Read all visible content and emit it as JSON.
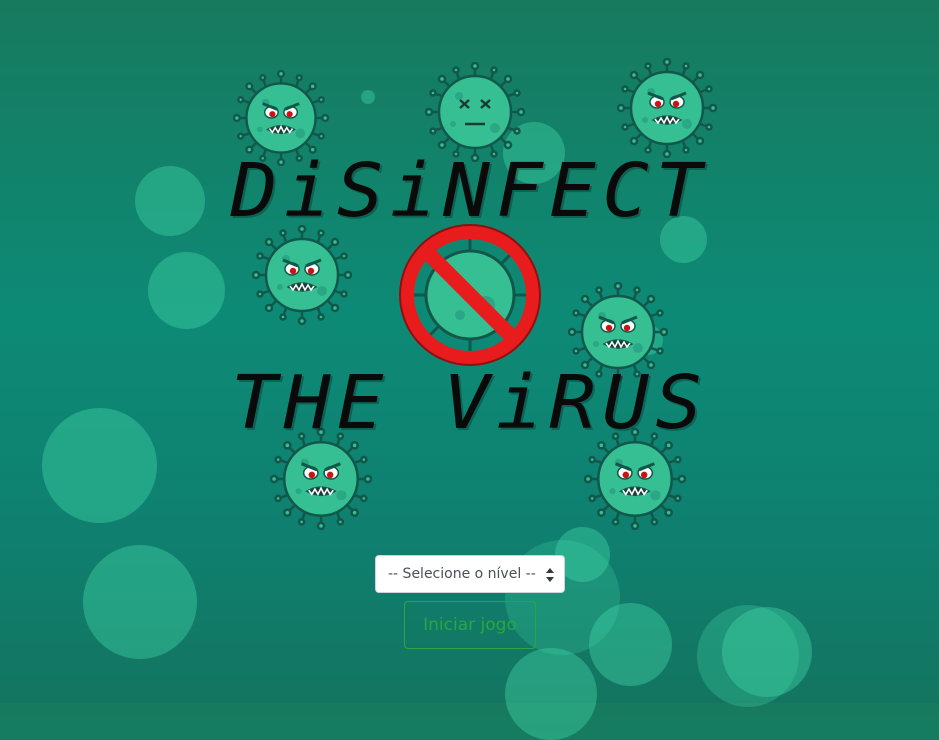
{
  "title": {
    "line1": "DiSiNFECT",
    "line2": "THE ViRUS"
  },
  "level_select": {
    "selected": "-- Selecione o nível --",
    "options": [
      "-- Selecione o nível --"
    ]
  },
  "start_button": {
    "label": "Iniciar jogo"
  },
  "icons": {
    "virus": "angry-virus-icon",
    "dead_virus": "dead-virus-icon",
    "no_virus": "no-virus-icon",
    "select_arrows": "sort-arrows-icon"
  },
  "colors": {
    "background": "#0d8a76",
    "bubble": "#40d6a8",
    "virus_body": "#37bf94",
    "virus_outline": "#11584a",
    "prohibition_red": "#e81c1c",
    "button_outline": "#28a745",
    "title_text": "#0a0a0a"
  }
}
